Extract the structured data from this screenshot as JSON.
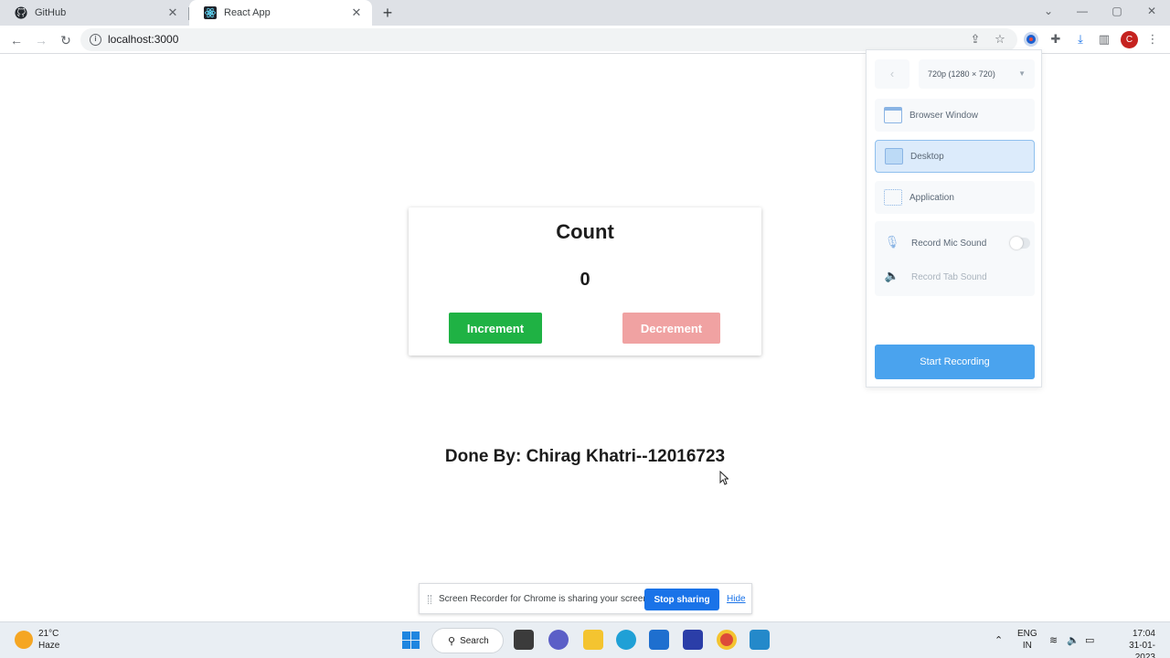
{
  "browser": {
    "tabs": [
      {
        "title": "GitHub",
        "icon": "github-icon"
      },
      {
        "title": "React App",
        "icon": "react-icon",
        "active": true
      }
    ],
    "url": "localhost:3000"
  },
  "app": {
    "title": "Count",
    "count": "0",
    "increment_label": "Increment",
    "decrement_label": "Decrement",
    "credit": "Done By: Chirag Khatri--12016723",
    "colors": {
      "increment": "#1fb244",
      "decrement": "#f0a2a2"
    }
  },
  "recorder": {
    "resolution": "720p (1280 × 720)",
    "sources": [
      "Browser Window",
      "Desktop",
      "Application"
    ],
    "selected_source": "Desktop",
    "mic_label": "Record Mic Sound",
    "tab_sound_label": "Record Tab Sound",
    "start_label": "Start Recording",
    "accent": "#4aa3ee"
  },
  "share_bar": {
    "message": "Screen Recorder for Chrome is sharing your screen.",
    "stop_label": "Stop sharing",
    "hide_label": "Hide"
  },
  "taskbar": {
    "temperature": "21°C",
    "condition": "Haze",
    "search_label": "Search",
    "language": "ENG",
    "region": "IN",
    "time": "17:04",
    "date": "31-01-2023"
  }
}
